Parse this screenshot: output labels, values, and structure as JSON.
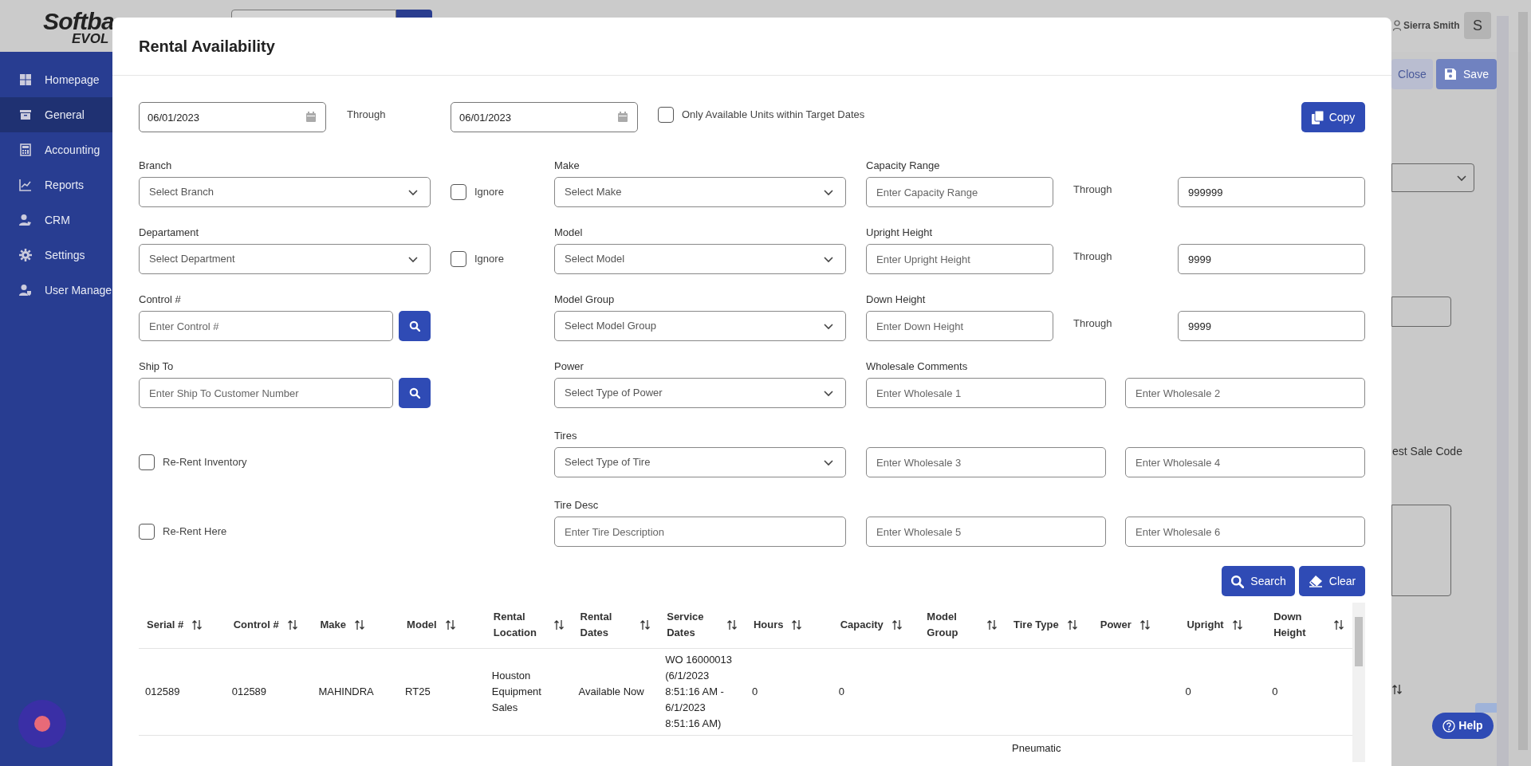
{
  "app": {
    "logo": {
      "line_1": "Softba",
      "line_2": "EVOL"
    },
    "user_name": "Sierra Smith",
    "avatar_initial": "S",
    "toolbar_buttons": [
      {
        "label": "Close",
        "kind": "close"
      },
      {
        "label": "Save",
        "kind": "save"
      }
    ],
    "side_label": "est Sale Code",
    "help_button": "Help"
  },
  "sidebar": {
    "items": [
      {
        "label": "Homepage",
        "selected": false
      },
      {
        "label": "General",
        "selected": true
      },
      {
        "label": "Accounting",
        "selected": false
      },
      {
        "label": "Reports",
        "selected": false
      },
      {
        "label": "CRM",
        "selected": false
      },
      {
        "label": "Settings",
        "selected": false
      },
      {
        "label": "User Manage",
        "selected": false
      }
    ]
  },
  "modal": {
    "title": "Rental Availability",
    "date_from": "06/01/2023",
    "through_label": "Through",
    "date_to": "06/01/2023",
    "available_only": {
      "label": "Only Available Units within Target Dates",
      "checked": false
    },
    "copy_button": "Copy",
    "column_1": [
      {
        "kind": "select",
        "label": "Branch",
        "placeholder": "Select Branch",
        "ignore": {
          "label": "Ignore",
          "checked": false
        }
      },
      {
        "kind": "select",
        "label": "Departament",
        "placeholder": "Select Department",
        "ignore": {
          "label": "Ignore",
          "checked": false
        }
      },
      {
        "kind": "lookup",
        "label": "Control #",
        "placeholder": "Enter Control #"
      },
      {
        "kind": "lookup",
        "label": "Ship To",
        "placeholder": "Enter Ship To Customer Number"
      },
      {
        "kind": "checkbox",
        "label": "Re-Rent Inventory",
        "checked": false
      },
      {
        "kind": "checkbox",
        "label": "Re-Rent Here",
        "checked": false
      }
    ],
    "column_2": [
      {
        "kind": "select",
        "label": "Make",
        "placeholder": "Select Make"
      },
      {
        "kind": "select",
        "label": "Model",
        "placeholder": "Select Model"
      },
      {
        "kind": "select",
        "label": "Model Group",
        "placeholder": "Select Model Group"
      },
      {
        "kind": "select",
        "label": "Power",
        "placeholder": "Select Type of Power"
      },
      {
        "kind": "select",
        "label": "Tires",
        "placeholder": "Select Type of Tire"
      },
      {
        "kind": "text",
        "label": "Tire Desc",
        "placeholder": "Enter Tire Description"
      }
    ],
    "ranges": [
      {
        "label": "Capacity Range",
        "placeholder": "Enter Capacity Range",
        "through_label": "Through",
        "value_to": "999999"
      },
      {
        "label": "Upright Height",
        "placeholder": "Enter Upright Height",
        "through_label": "Through",
        "value_to": "9999"
      },
      {
        "label": "Down Height",
        "placeholder": "Enter Down Height",
        "through_label": "Through",
        "value_to": "9999"
      }
    ],
    "wholesale": {
      "label": "Wholesale Comments",
      "placeholders": [
        "Enter Wholesale 1",
        "Enter Wholesale 2",
        "Enter Wholesale 3",
        "Enter Wholesale 4",
        "Enter Wholesale 5",
        "Enter Wholesale 6"
      ]
    },
    "search_button": "Search",
    "clear_button": "Clear",
    "table": {
      "columns": [
        "Serial #",
        "Control #",
        "Make",
        "Model",
        "Rental Location",
        "Rental Dates",
        "Service Dates",
        "Hours",
        "Capacity",
        "Model Group",
        "Tire Type",
        "Power",
        "Upright",
        "Down Height"
      ],
      "rows": [
        [
          "012589",
          "012589",
          "MAHINDRA",
          "RT25",
          "Houston Equipment Sales",
          "Available Now",
          "WO 16000013 (6/1/2023 8:51:16 AM - 6/1/2023 8:51:16 AM)",
          "0",
          "0",
          null,
          null,
          null,
          "0",
          "0"
        ],
        [
          null,
          null,
          null,
          null,
          null,
          null,
          null,
          null,
          null,
          null,
          "Pneumatic",
          null,
          null,
          null
        ]
      ]
    }
  }
}
